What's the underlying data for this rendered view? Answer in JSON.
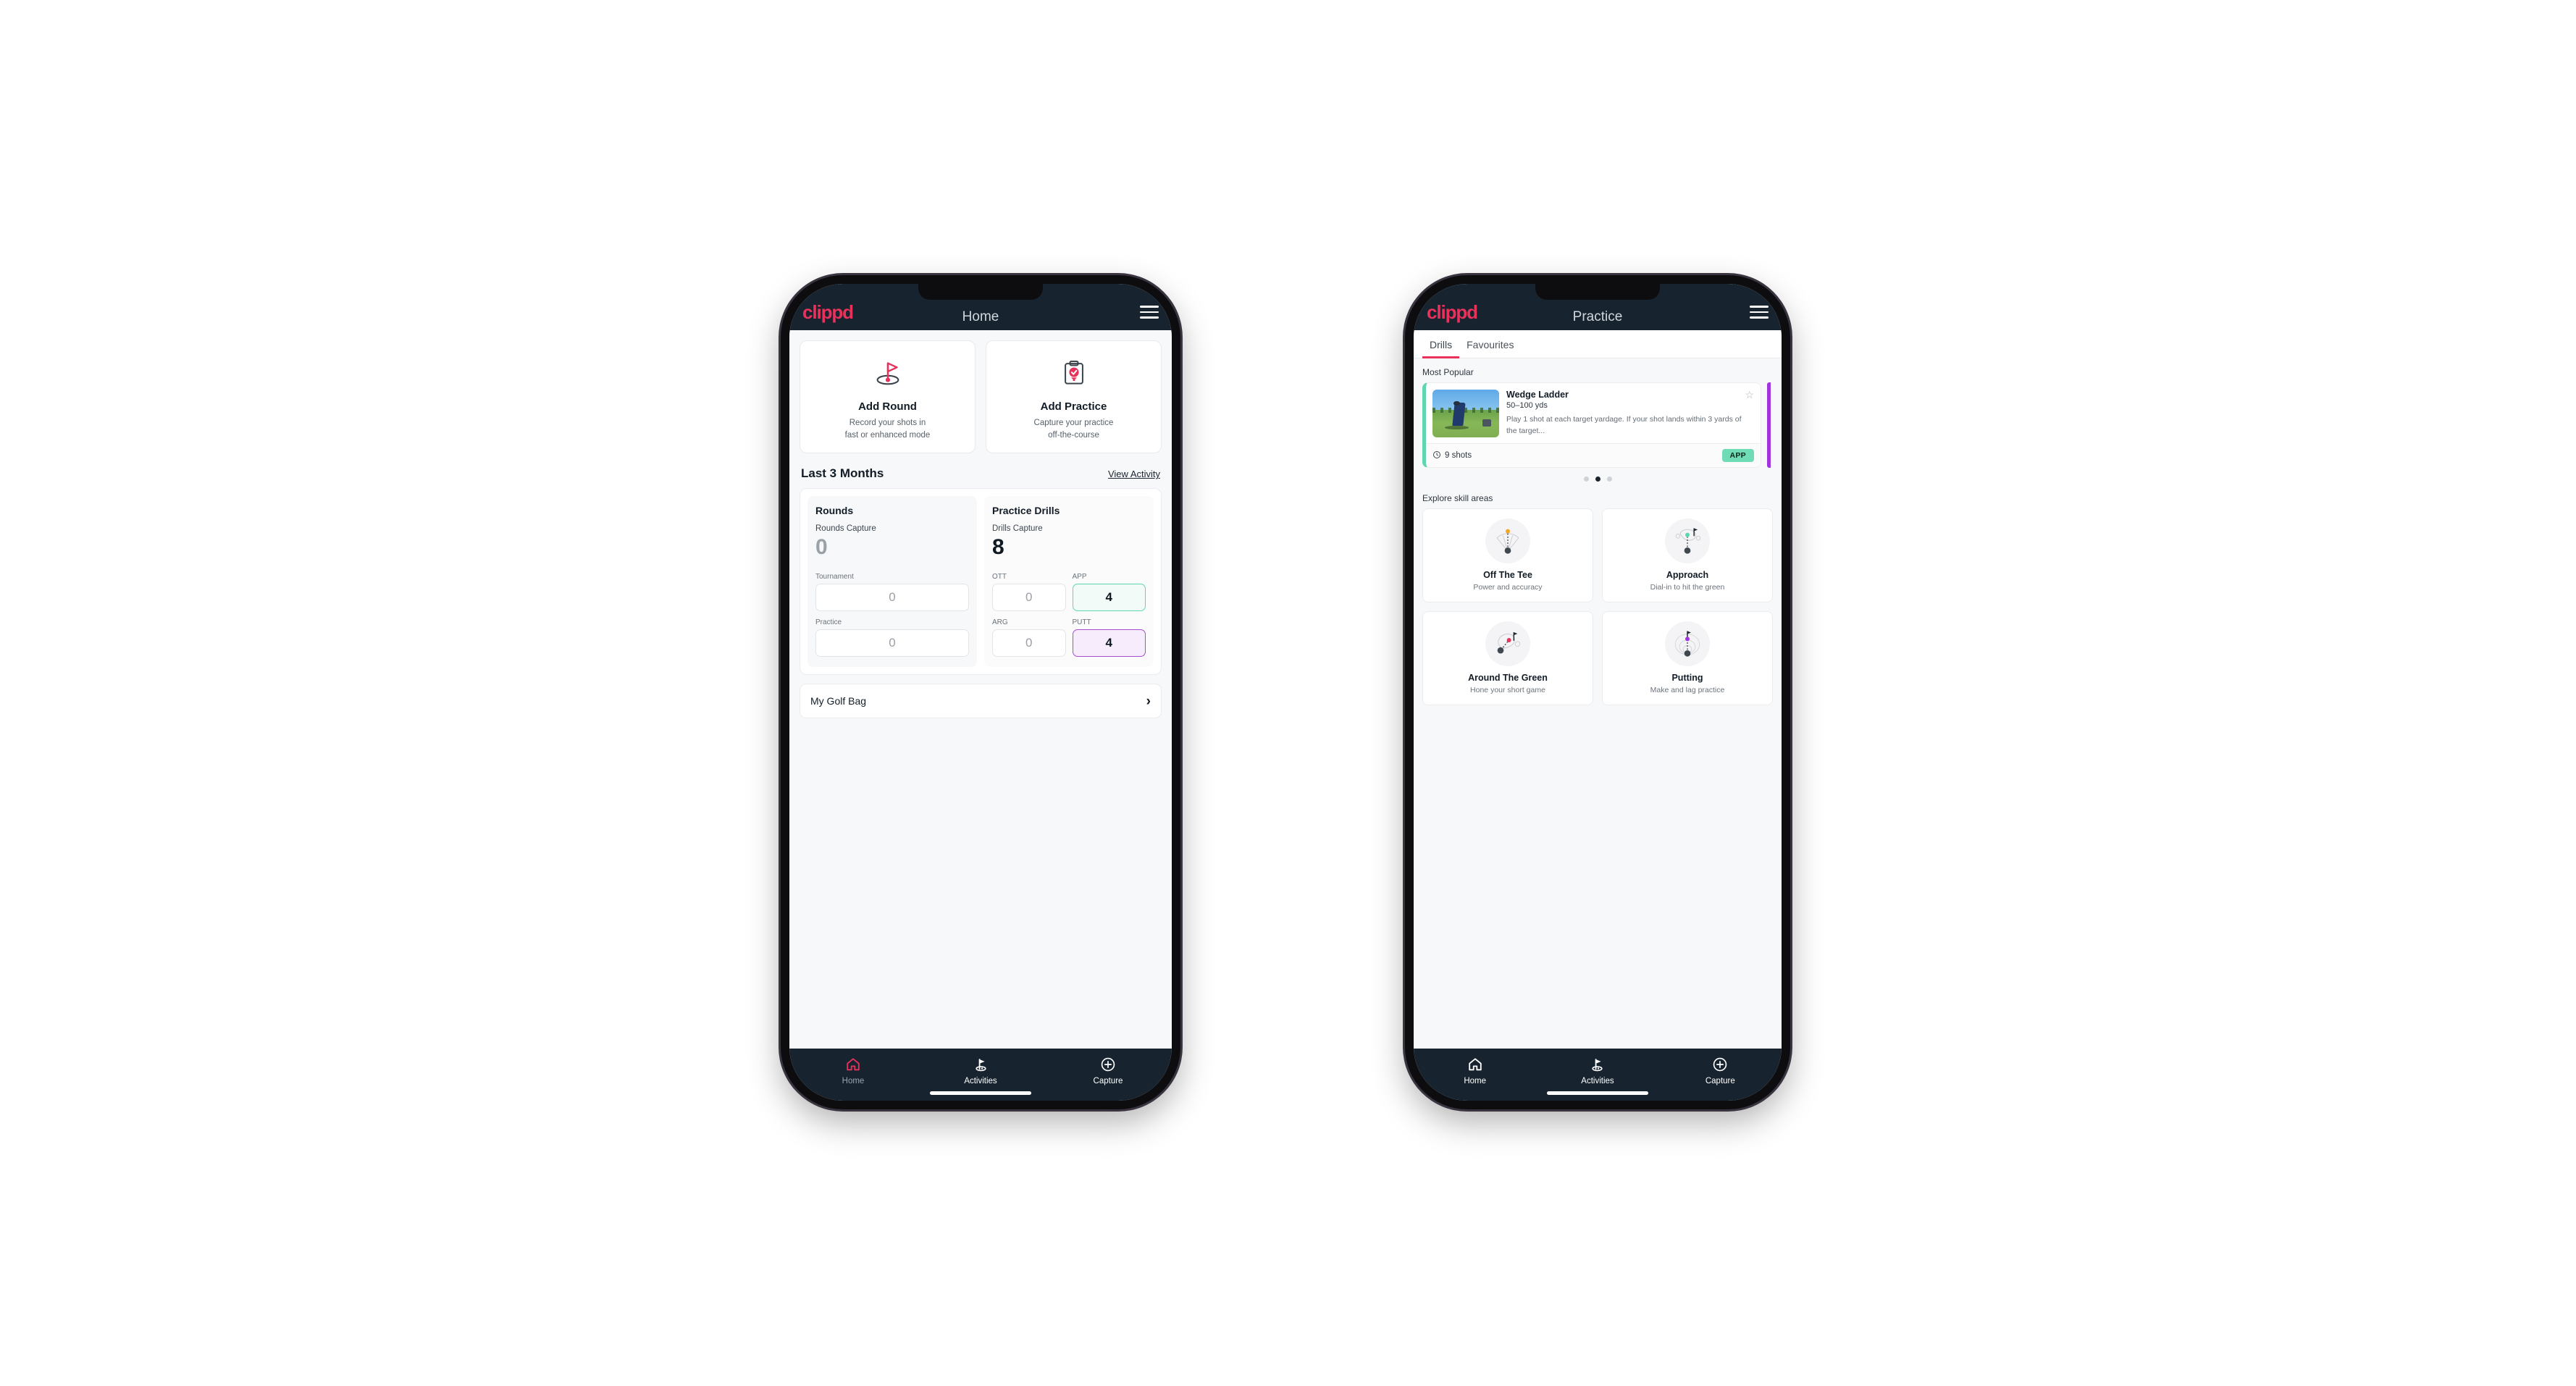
{
  "colors": {
    "brand_pink": "#e8315b",
    "header_navy": "#17242f",
    "teal": "#5fd6b0",
    "purple": "#a64dd4",
    "page_bg": "#ffffff"
  },
  "phone_home": {
    "appbar": {
      "logo": "clippd",
      "title": "Home",
      "menu_icon": "hamburger-icon"
    },
    "actions": [
      {
        "icon": "golf-flag-icon",
        "title": "Add Round",
        "desc_line1": "Record your shots in",
        "desc_line2": "fast or enhanced mode"
      },
      {
        "icon": "clipboard-check-icon",
        "title": "Add Practice",
        "desc_line1": "Capture your practice",
        "desc_line2": "off-the-course"
      }
    ],
    "section": {
      "title": "Last 3 Months",
      "link": "View Activity"
    },
    "stats": {
      "rounds": {
        "heading": "Rounds",
        "capture_label": "Rounds Capture",
        "capture_value": "0",
        "fields": [
          {
            "label": "Tournament",
            "value": "0",
            "state": "plain"
          },
          {
            "label": "Practice",
            "value": "0",
            "state": "plain"
          }
        ]
      },
      "practice_drills": {
        "heading": "Practice Drills",
        "capture_label": "Drills Capture",
        "capture_value": "8",
        "fields": [
          {
            "label": "OTT",
            "value": "0",
            "state": "plain"
          },
          {
            "label": "APP",
            "value": "4",
            "state": "teal"
          },
          {
            "label": "ARG",
            "value": "0",
            "state": "plain"
          },
          {
            "label": "PUTT",
            "value": "4",
            "state": "purple"
          }
        ]
      }
    },
    "golf_bag": {
      "label": "My Golf Bag",
      "chevron_icon": "chevron-right-icon"
    },
    "bottom_nav": [
      {
        "icon": "home-icon",
        "label": "Home",
        "active": true
      },
      {
        "icon": "golf-flag-icon",
        "label": "Activities",
        "active": false
      },
      {
        "icon": "plus-circle-icon",
        "label": "Capture",
        "active": false
      }
    ]
  },
  "phone_practice": {
    "appbar": {
      "logo": "clippd",
      "title": "Practice",
      "menu_icon": "hamburger-icon"
    },
    "tabs": [
      {
        "label": "Drills",
        "active": true
      },
      {
        "label": "Favourites",
        "active": false
      }
    ],
    "most_popular_label": "Most Popular",
    "drill_card": {
      "title": "Wedge Ladder",
      "yardage": "50–100 yds",
      "description": "Play 1 shot at each target yardage. If your shot lands within 3 yards of the target...",
      "shots": "9 shots",
      "shots_icon": "clock-icon",
      "chip": "APP",
      "star_icon": "star-outline-icon",
      "accent_color": "#5fd6b0",
      "next_card_accent": "#a233e0",
      "thumbnail": "golfer-wedge-shot-photo"
    },
    "carousel_dots": {
      "count": 3,
      "active_index": 1
    },
    "explore_label": "Explore skill areas",
    "skill_areas": [
      {
        "icon": "tee-shot-fan-icon",
        "title": "Off The Tee",
        "desc": "Power and accuracy"
      },
      {
        "icon": "approach-green-icon",
        "title": "Approach",
        "desc": "Dial-in to hit the green"
      },
      {
        "icon": "around-green-icon",
        "title": "Around The Green",
        "desc": "Hone your short game"
      },
      {
        "icon": "putting-rings-icon",
        "title": "Putting",
        "desc": "Make and lag practice"
      }
    ],
    "bottom_nav": [
      {
        "icon": "home-icon",
        "label": "Home",
        "active": false
      },
      {
        "icon": "golf-flag-icon",
        "label": "Activities",
        "active": false
      },
      {
        "icon": "plus-circle-icon",
        "label": "Capture",
        "active": false
      }
    ]
  }
}
